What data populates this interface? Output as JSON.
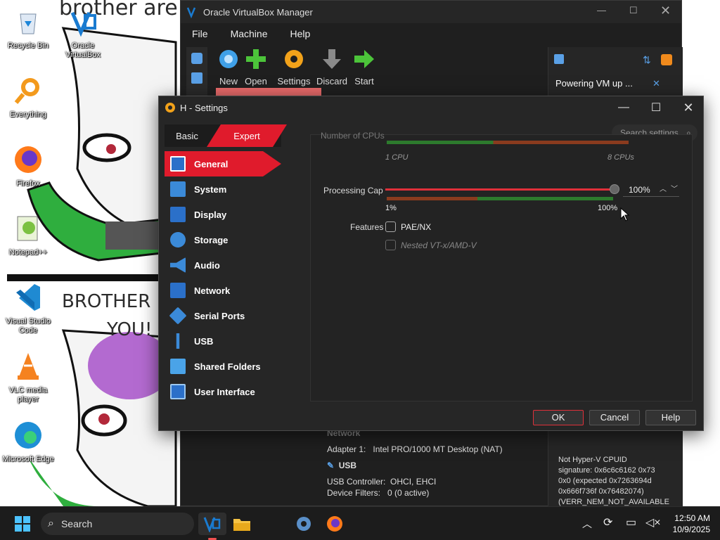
{
  "desktop": {
    "wallpaper_text_top": "brother are",
    "wallpaper_text_mid": "BROTHER",
    "wallpaper_text_you": "YOU!",
    "icons": [
      {
        "label": "Recycle Bin"
      },
      {
        "label": "Oracle VirtualBox"
      },
      {
        "label": "Everything"
      },
      {
        "label": "Firefox"
      },
      {
        "label": "Notepad++"
      },
      {
        "label": "Visual Studio Code"
      },
      {
        "label": "VLC media player"
      },
      {
        "label": "Microsoft Edge"
      }
    ]
  },
  "manager": {
    "title": "Oracle VirtualBox Manager",
    "menu": [
      "File",
      "Machine",
      "Help"
    ],
    "toolbar": [
      "New",
      "Open",
      "Settings",
      "Discard",
      "Start"
    ],
    "notification": "Powering VM up ...",
    "network_heading": "Network",
    "adapter_label": "Adapter 1:",
    "adapter_value": "Intel PRO/1000 MT Desktop (NAT)",
    "usb_heading": "USB",
    "usb_controller_label": "USB Controller:",
    "usb_controller_value": "OHCI, EHCI",
    "device_filters_label": "Device Filters:",
    "device_filters_value": "0 (0 active)",
    "log_lines": [
      "Not Hyper-V CPUID",
      "signature: 0x6c6c6162 0x73",
      "0x0 (expected 0x7263694d",
      "0x666f736f 0x76482074)",
      "(VERR_NEM_NOT_AVAILABLE"
    ]
  },
  "settings": {
    "title": "H - Settings",
    "mode_basic": "Basic",
    "mode_expert": "Expert",
    "search_placeholder": "Search settings",
    "categories": [
      "General",
      "System",
      "Display",
      "Storage",
      "Audio",
      "Network",
      "Serial Ports",
      "USB",
      "Shared Folders",
      "User Interface"
    ],
    "cpu_label": "Number of CPUs",
    "cpu_min": "1 CPU",
    "cpu_max": "8 CPUs",
    "cap_label": "Processing Cap",
    "cap_value": "100%",
    "cap_fraction": 1.0,
    "cap_min": "1%",
    "cap_max": "100%",
    "features_label": "Features",
    "pae": "PAE/NX",
    "nested": "Nested VT-x/AMD-V",
    "ok": "OK",
    "cancel": "Cancel",
    "help": "Help"
  },
  "taskbar": {
    "search": "Search",
    "time": "12:50 AM",
    "date": "10/9/2025"
  }
}
